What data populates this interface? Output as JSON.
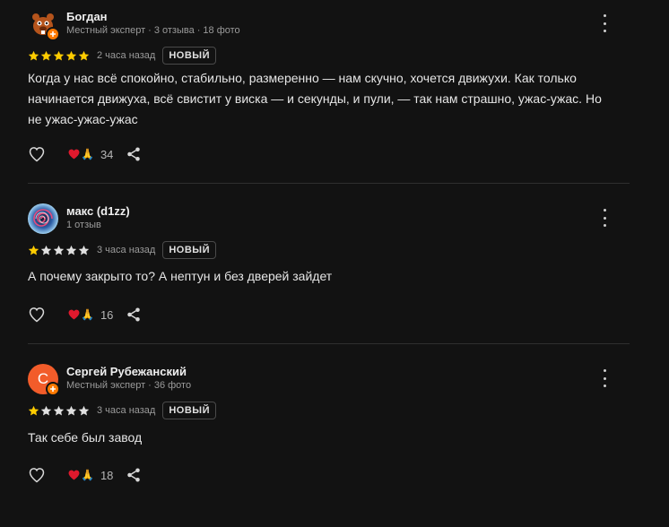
{
  "reviews": [
    {
      "author": "Богдан",
      "meta_role": "Местный эксперт",
      "meta_reviews": "3 отзыва",
      "meta_photos": "18 фото",
      "rating": 5,
      "time": "2 часа назад",
      "badge": "НОВЫЙ",
      "text": "Когда у нас всё спокойно, стабильно, размеренно — нам скучно, хочется движухи. Как только начинается движуха, всё свистит у виска — и секунды, и пули, — так нам страшно, ужас-ужас. Но не ужас-ужас-ужас",
      "reactions_count": "34",
      "avatar_icon": "beaver-avatar-icon"
    },
    {
      "author": "макс (d1zz)",
      "meta_reviews": "1 отзыв",
      "rating": 1,
      "time": "3 часа назад",
      "badge": "НОВЫЙ",
      "text": "А почему закрыто то? А нептун и без дверей зайдет",
      "reactions_count": "16",
      "avatar_icon": "spiral-avatar-icon"
    },
    {
      "author": "Сергей Рубежанский",
      "avatar_letter": "С",
      "meta_role": "Местный эксперт",
      "meta_photos": "36 фото",
      "rating": 1,
      "time": "3 часа назад",
      "badge": "НОВЫЙ",
      "text": "Так себе был завод",
      "reactions_count": "18",
      "avatar_color": "#f25c2a"
    }
  ],
  "colors": {
    "background": "#121212",
    "star_filled": "#ffcc00",
    "star_empty": "#e0e0e0",
    "expert_badge": "#ff7a00",
    "heart": "#e0192d"
  }
}
